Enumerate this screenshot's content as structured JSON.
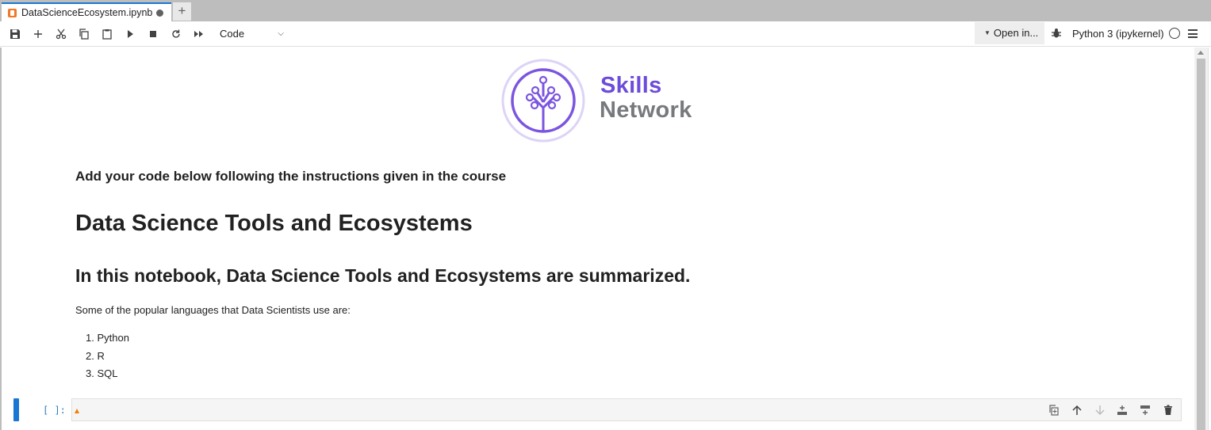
{
  "tabs": [
    {
      "label": "DataScienceEcosystem.ipynb",
      "icon": "notebook-icon",
      "dirty": true
    }
  ],
  "tab_add_label": "+",
  "toolbar": {
    "cell_type": "Code",
    "open_in_label": "Open in...",
    "kernel_name": "Python 3 (ipykernel)",
    "icons": [
      "save-icon",
      "add-cell-icon",
      "cut-icon",
      "copy-icon",
      "paste-icon",
      "run-icon",
      "stop-icon",
      "restart-icon",
      "run-all-icon"
    ]
  },
  "logo": {
    "line1": "Skills",
    "line2": "Network",
    "colors": {
      "skills": "#6d4bdc",
      "network": "#77797d"
    }
  },
  "markdown": {
    "instructions": "Add your code below following the instructions given in the course",
    "h1": "Data Science Tools and Ecosystems",
    "h2": "In this notebook, Data Science Tools and Ecosystems are summarized.",
    "paragraph": "Some of the popular languages that Data Scientists use are:",
    "list": [
      "Python",
      "R",
      "SQL"
    ]
  },
  "code_cell": {
    "prompt": "[ ]:",
    "content": "",
    "toolbar_icons": [
      "duplicate-icon",
      "move-up-icon",
      "move-down-icon",
      "insert-above-icon",
      "insert-below-icon",
      "delete-icon"
    ]
  },
  "colors": {
    "accent": "#1976d2",
    "tab_bar": "#bdbdbd",
    "cell_bg": "#f5f5f5"
  }
}
